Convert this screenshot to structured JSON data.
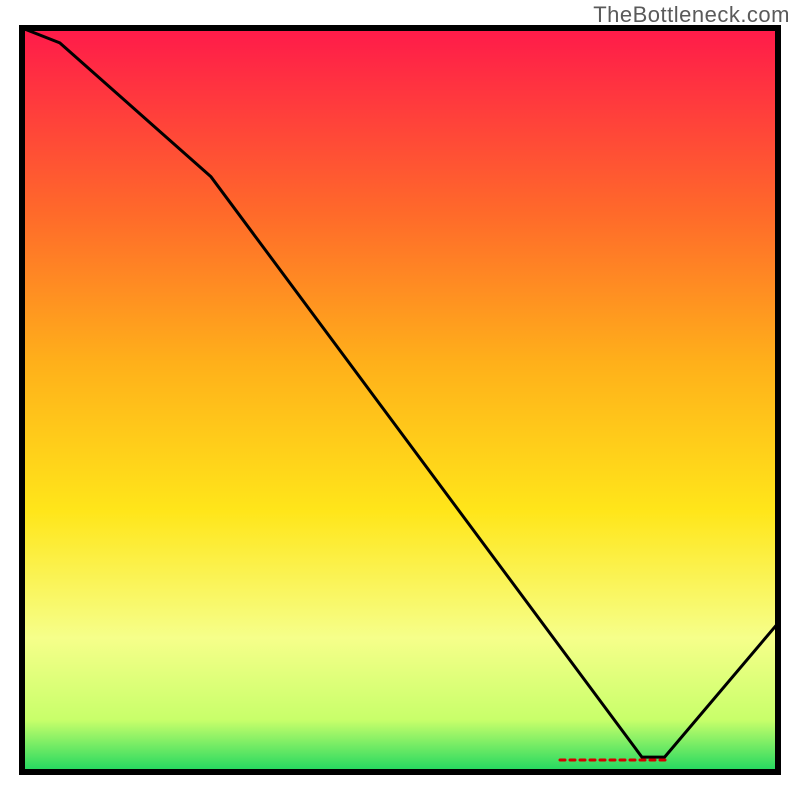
{
  "watermark": "TheBottleneck.com",
  "chart_data": {
    "type": "line",
    "title": "",
    "xlabel": "",
    "ylabel": "",
    "xlim": [
      0,
      100
    ],
    "ylim": [
      0,
      100
    ],
    "x": [
      0,
      5,
      25,
      82,
      85,
      100
    ],
    "values": [
      100,
      98,
      80,
      2,
      2,
      20
    ],
    "min_zone_label": "",
    "background_gradient": {
      "top": "#ff1a4a",
      "mid1": "#ff9a1a",
      "mid2": "#ffe61a",
      "mid3": "#f6ff8a",
      "bottom": "#1ed760"
    },
    "description": "Gradient background from red (high bottleneck) at top to green (no bottleneck) at bottom; black line descends steeply then flattens near the bottom-right before rising slightly."
  }
}
